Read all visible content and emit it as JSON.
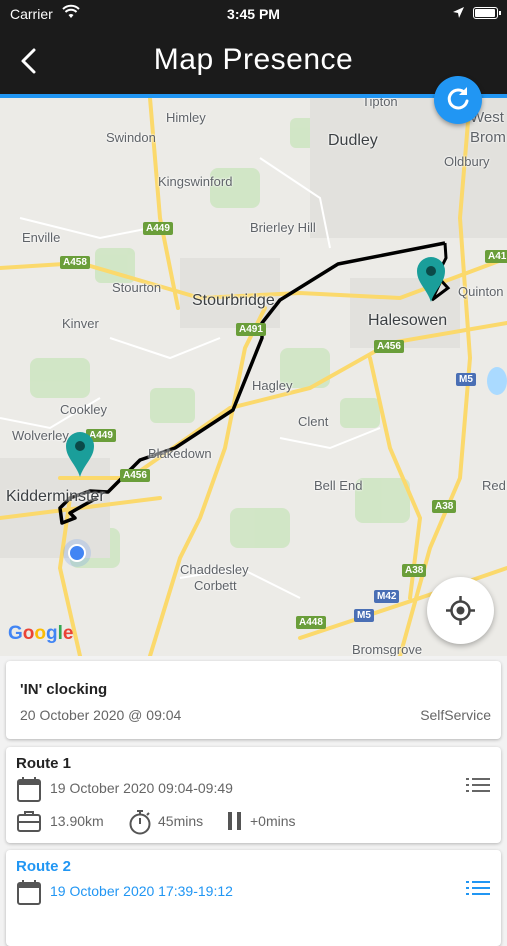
{
  "status_bar": {
    "carrier": "Carrier",
    "time": "3:45 PM",
    "icons": [
      "wifi-icon",
      "location-arrow-icon",
      "battery-icon"
    ],
    "battery_level": 1.0
  },
  "navbar": {
    "title": "Map Presence",
    "back_icon": "chevron-left-icon",
    "refresh_icon": "refresh-icon"
  },
  "map": {
    "places": {
      "tipton": "Tipton",
      "himley": "Himley",
      "dudley": "Dudley",
      "swindon": "Swindon",
      "west_brom": "West Brom",
      "oldbury": "Oldbury",
      "kingswinford": "Kingswinford",
      "brierley_hill": "Brierley Hill",
      "enville": "Enville",
      "stourton": "Stourton",
      "stourbridge": "Stourbridge",
      "quinton": "Quinton",
      "kinver": "Kinver",
      "halesowen": "Halesowen",
      "hagley": "Hagley",
      "cookley": "Cookley",
      "clent": "Clent",
      "wolverley": "Wolverley",
      "blakedown": "Blakedown",
      "kidderminster": "Kidderminster",
      "bell_end": "Bell End",
      "red": "Red",
      "chaddesley": "Chaddesley",
      "corbett": "Corbett",
      "bromsgrove": "Bromsgrove"
    },
    "road_badges": {
      "a449_top": "A449",
      "a458": "A458",
      "a41": "A41",
      "a491": "A491",
      "a456_right": "A456",
      "m5_upper": "M5",
      "a449_left": "A449",
      "a456_left": "A456",
      "a38_upper": "A38",
      "a38_lower": "A38",
      "m42": "M42",
      "m5_lower": "M5",
      "a448": "A448"
    },
    "logo": [
      "G",
      "o",
      "o",
      "g",
      "l",
      "e"
    ],
    "locate_icon": "my-location-icon",
    "colors": {
      "pin": "#1a9e9a",
      "route_line": "#000000",
      "current_location": "#4285f4"
    }
  },
  "clocking": {
    "title": "'IN' clocking",
    "date": "20 October 2020 @ 09:04",
    "source": "SelfService"
  },
  "routes": [
    {
      "name": "Route 1",
      "datetime": "19 October 2020 09:04-09:49",
      "distance": "13.90km",
      "duration": "45mins",
      "pause": "+0mins"
    },
    {
      "name": "Route 2",
      "datetime": "19 October 2020 17:39-19:12"
    }
  ],
  "accent_color": "#2196f3"
}
